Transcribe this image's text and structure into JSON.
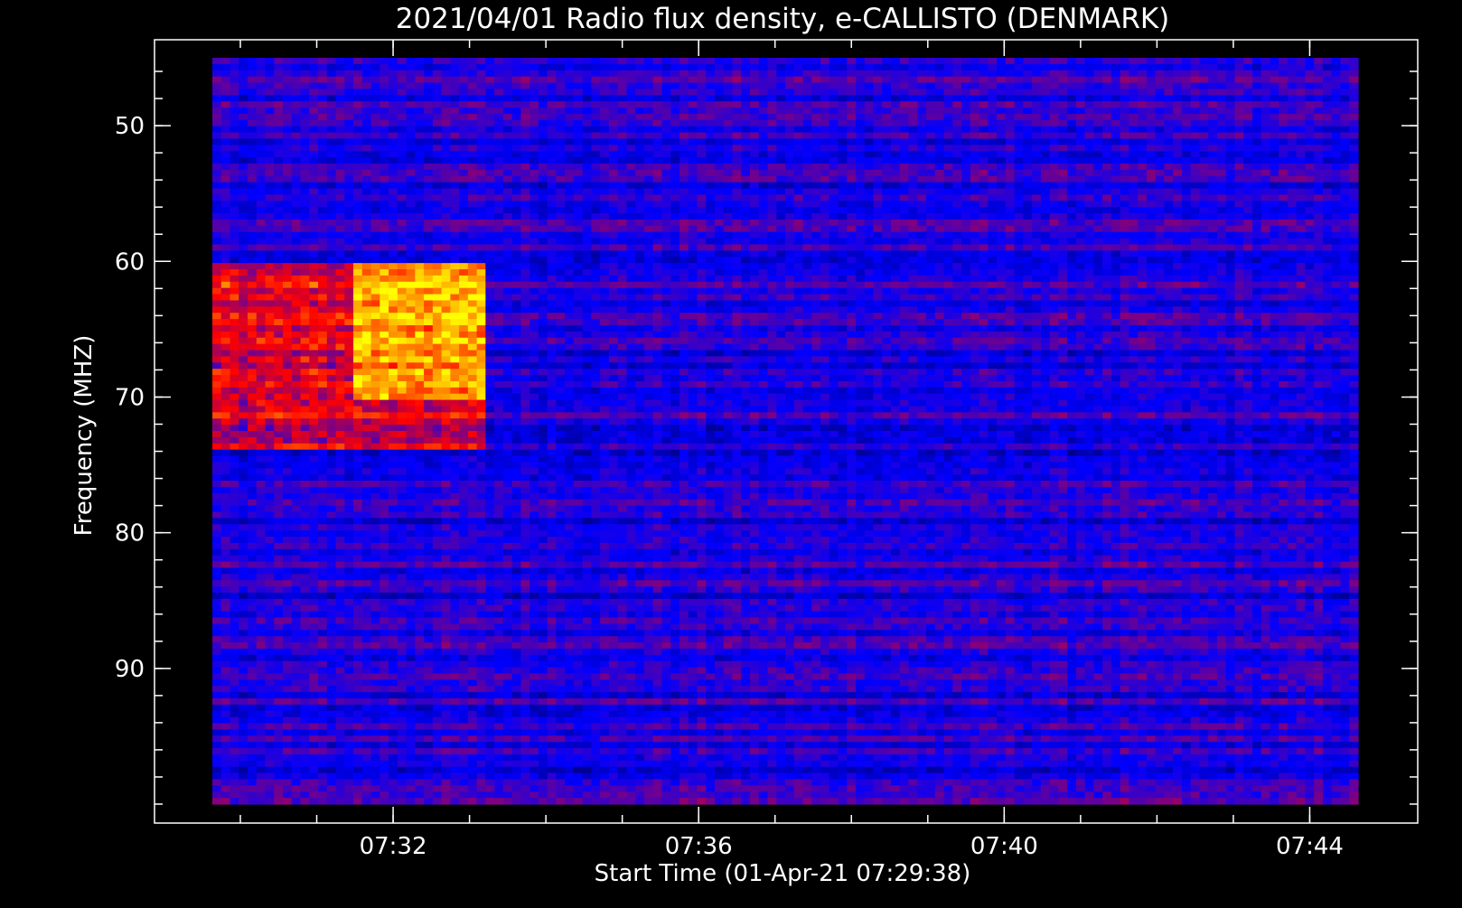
{
  "chart_data": {
    "type": "heatmap",
    "title": "2021/04/01  Radio flux density, e-CALLISTO (DENMARK)",
    "xlabel": "Start Time (01-Apr-21 07:29:38)",
    "ylabel": "Frequency (MHZ)",
    "x_unit": "UT time",
    "x_range": [
      "07:29:38",
      "07:44:38"
    ],
    "y_range": [
      45,
      100
    ],
    "y_inverted": true,
    "x_ticks": [
      "07:32",
      "07:36",
      "07:40",
      "07:44"
    ],
    "y_ticks": [
      50,
      60,
      70,
      80,
      90
    ],
    "grid": false,
    "colormap": [
      "#000000",
      "#0000ff",
      "#ff0000",
      "#ffff00"
    ],
    "background_color": "#000000",
    "axis_color": "#ffffff",
    "bursts": [
      {
        "start": "07:29:38",
        "end": "07:33:15",
        "freq_low": 60,
        "freq_high": 74,
        "intensity": "strong"
      },
      {
        "start": "07:31:30",
        "end": "07:33:15",
        "freq_low": 60,
        "freq_high": 70,
        "intensity": "peak"
      }
    ]
  }
}
